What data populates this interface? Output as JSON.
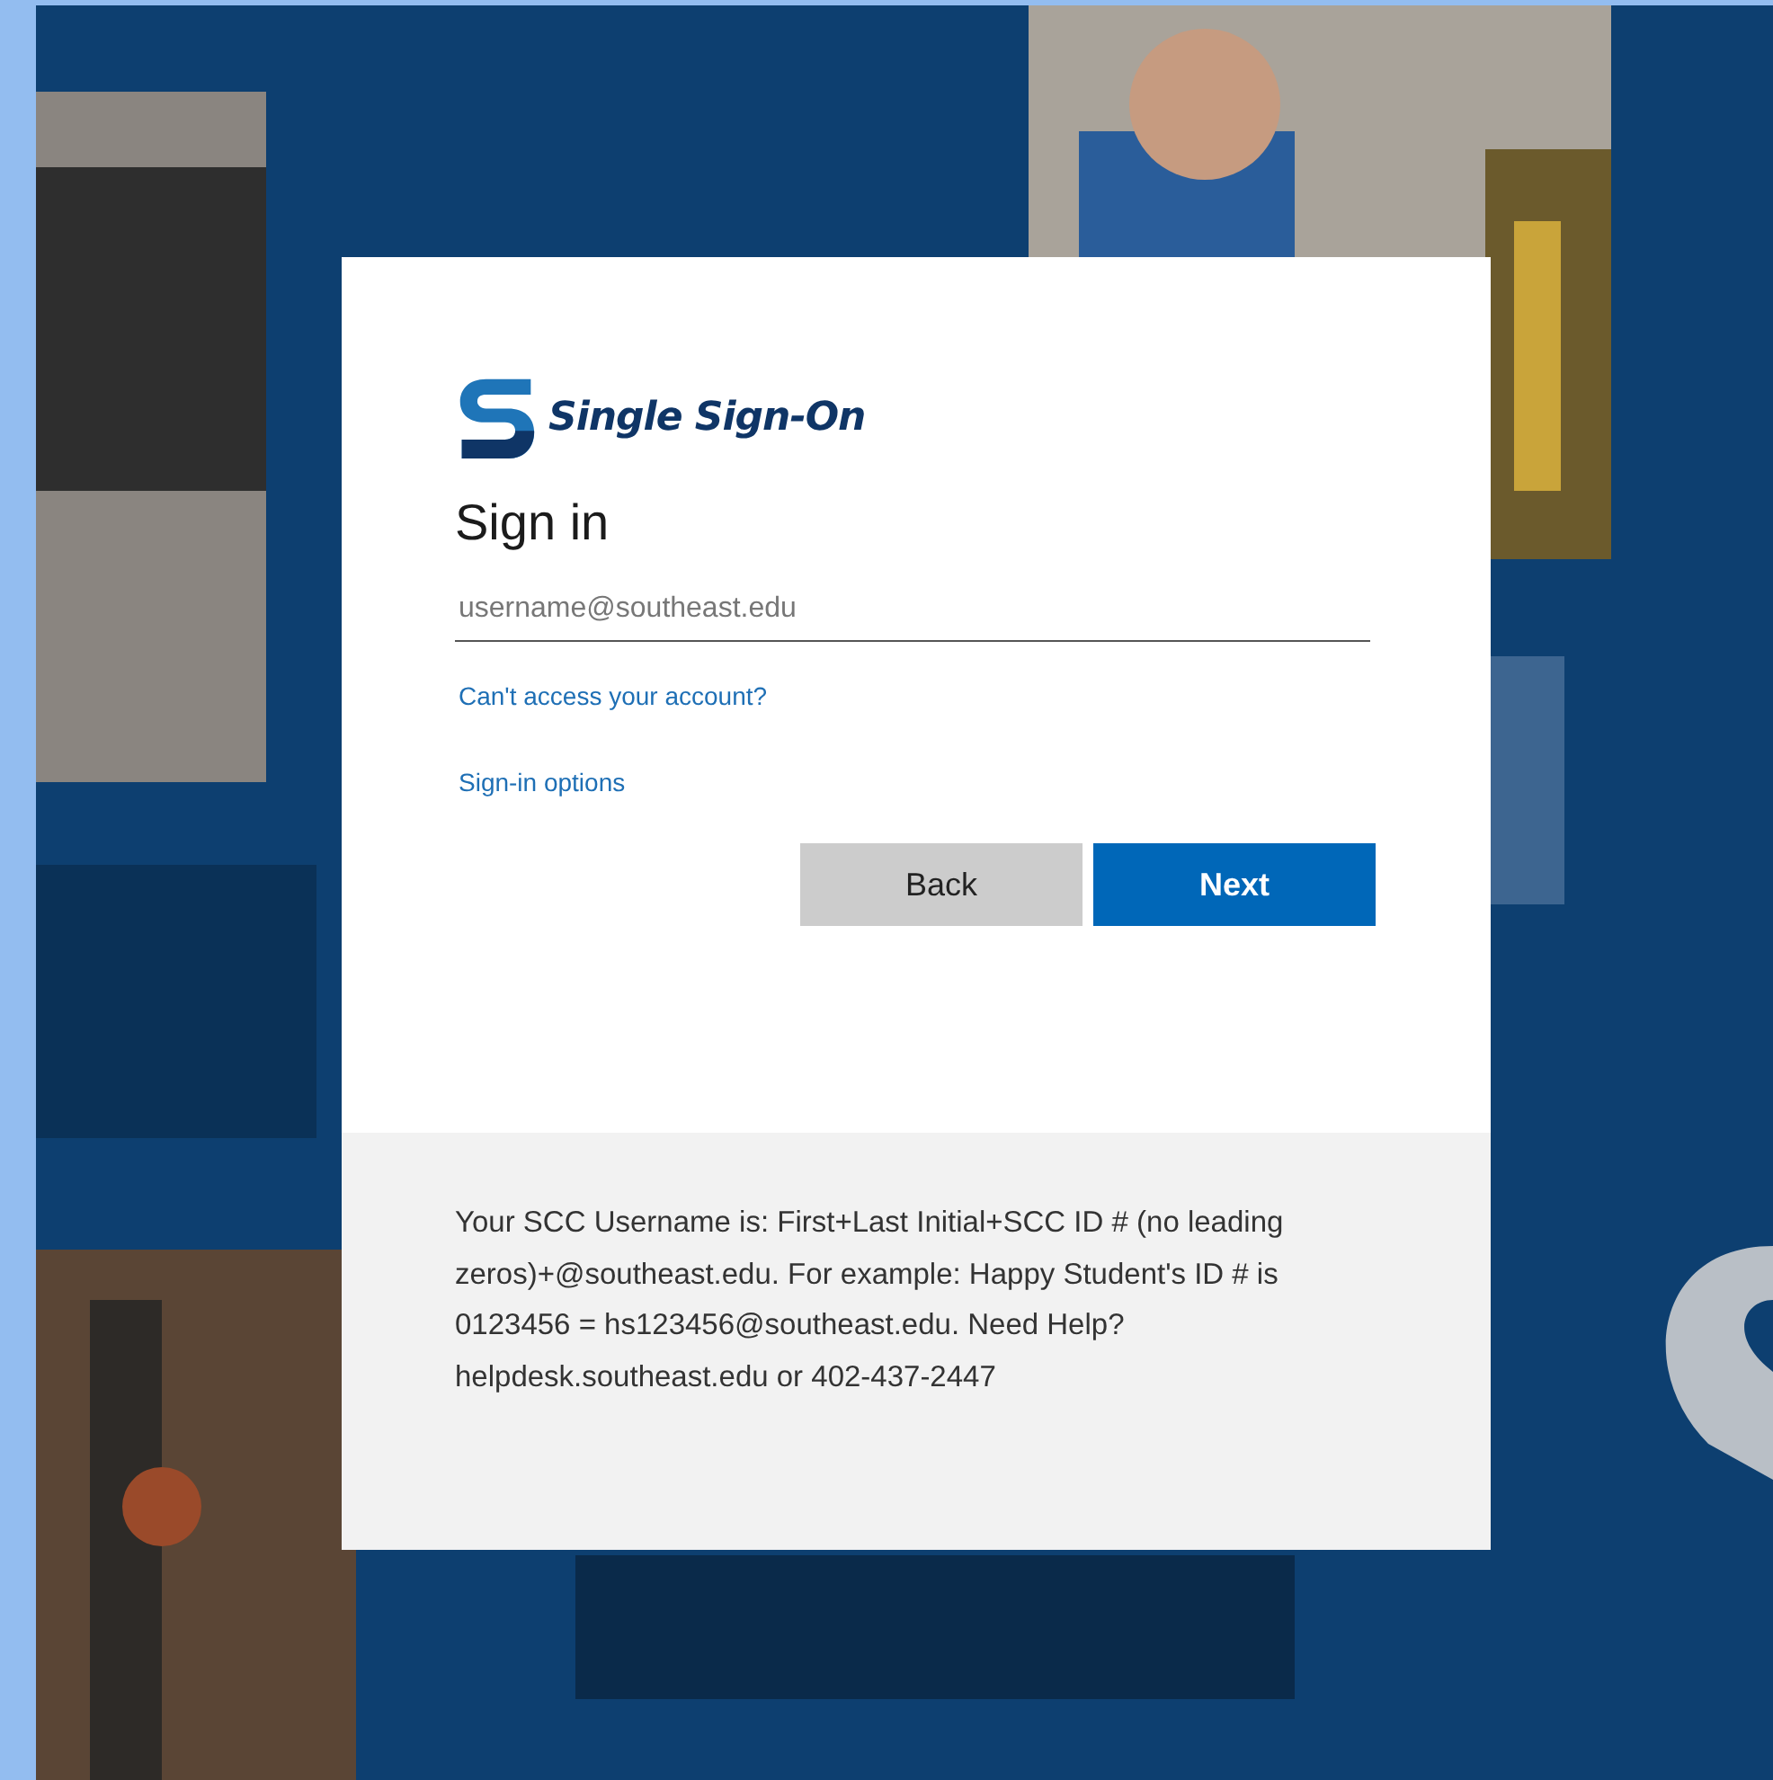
{
  "logo": {
    "text": "Single Sign-On"
  },
  "heading": "Sign in",
  "username_field": {
    "placeholder": "username@southeast.edu"
  },
  "links": [
    "Can't access your account?",
    "Sign-in options"
  ],
  "buttons": [
    {
      "label": "Back",
      "kind": "secondary"
    },
    {
      "label": "Next",
      "kind": "primary"
    }
  ],
  "footer": {
    "text": "Your SCC Username is: First+Last Initial+SCC ID # (no leading zeros)+@southeast.edu. For example: Happy Student's ID # is 0123456 = hs123456@southeast.edu. Need Help? helpdesk.southeast.edu or 402-437-2447"
  }
}
